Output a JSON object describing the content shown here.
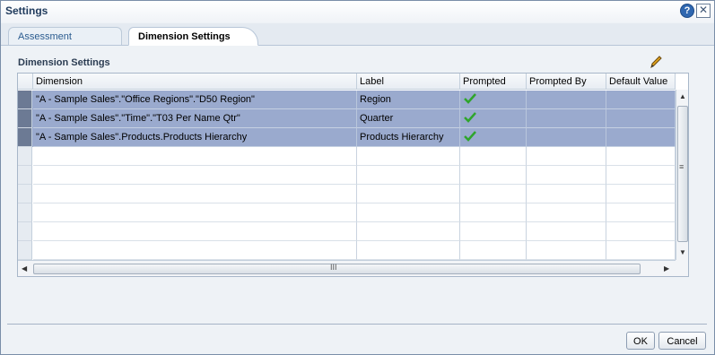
{
  "window": {
    "title": "Settings"
  },
  "tabs": [
    {
      "label": "Assessment Mappings"
    },
    {
      "label": "Dimension Settings"
    }
  ],
  "section": {
    "title": "Dimension Settings"
  },
  "table": {
    "columns": [
      "Dimension",
      "Label",
      "Prompted",
      "Prompted By",
      "Default Value"
    ],
    "rows": [
      {
        "dimension": "\"A - Sample Sales\".\"Office Regions\".\"D50 Region\"",
        "label": "Region",
        "prompted": true,
        "prompted_by": "",
        "default_value": ""
      },
      {
        "dimension": "\"A - Sample Sales\".\"Time\".\"T03 Per Name Qtr\"",
        "label": "Quarter",
        "prompted": true,
        "prompted_by": "",
        "default_value": ""
      },
      {
        "dimension": "\"A - Sample Sales\".Products.Products Hierarchy",
        "label": "Products Hierarchy",
        "prompted": true,
        "prompted_by": "",
        "default_value": ""
      }
    ],
    "scroll_grip": "III",
    "vscroll_grip": "≡"
  },
  "buttons": {
    "ok": "OK",
    "cancel": "Cancel"
  },
  "icons": {
    "help": "?",
    "close": "✕"
  },
  "colors": {
    "selected_row": "#9aaace",
    "check": "#2fa52c",
    "accent": "#2f67b0"
  }
}
